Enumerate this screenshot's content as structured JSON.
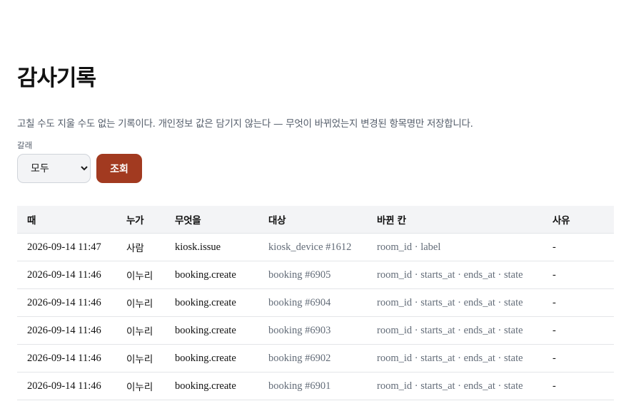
{
  "page": {
    "title": "감사기록",
    "description": "고칠 수도 지울 수도 없는 기록이다. 개인정보 값은 담기지 않는다 — 무엇이 바뀌었는지 변경된 항목명만 저장합니다."
  },
  "filter": {
    "label": "갈래",
    "selected": "모두",
    "submit_label": "조회"
  },
  "table": {
    "headers": {
      "when": "때",
      "who": "누가",
      "what": "무엇을",
      "target": "대상",
      "changed": "바뀐 칸",
      "reason": "사유"
    },
    "rows": [
      {
        "when": "2026-09-14 11:47",
        "who": "사람",
        "what": "kiosk.issue",
        "target": "kiosk_device #1612",
        "changed": "room_id · label",
        "reason": "-"
      },
      {
        "when": "2026-09-14 11:46",
        "who": "이누리",
        "what": "booking.create",
        "target": "booking #6905",
        "changed": "room_id · starts_at · ends_at · state",
        "reason": "-"
      },
      {
        "when": "2026-09-14 11:46",
        "who": "이누리",
        "what": "booking.create",
        "target": "booking #6904",
        "changed": "room_id · starts_at · ends_at · state",
        "reason": "-"
      },
      {
        "when": "2026-09-14 11:46",
        "who": "이누리",
        "what": "booking.create",
        "target": "booking #6903",
        "changed": "room_id · starts_at · ends_at · state",
        "reason": "-"
      },
      {
        "when": "2026-09-14 11:46",
        "who": "이누리",
        "what": "booking.create",
        "target": "booking #6902",
        "changed": "room_id · starts_at · ends_at · state",
        "reason": "-"
      },
      {
        "when": "2026-09-14 11:46",
        "who": "이누리",
        "what": "booking.create",
        "target": "booking #6901",
        "changed": "room_id · starts_at · ends_at · state",
        "reason": "-"
      }
    ]
  },
  "colors": {
    "accent": "#a23a20",
    "header_bg": "#f3f4f6",
    "muted_text": "#636c78"
  }
}
